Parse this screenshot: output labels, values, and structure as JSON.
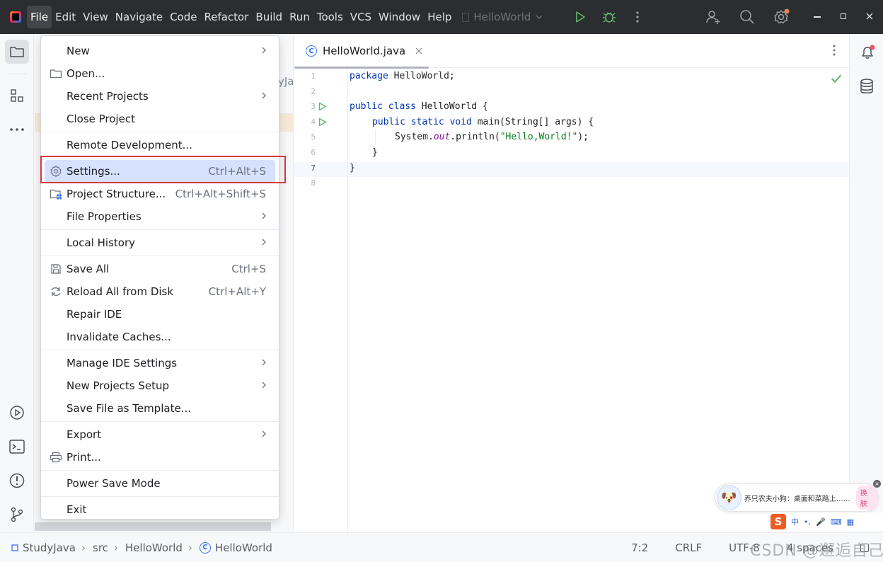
{
  "menubar": {
    "items": [
      "File",
      "Edit",
      "View",
      "Navigate",
      "Code",
      "Refactor",
      "Build",
      "Run",
      "Tools",
      "VCS",
      "Window",
      "Help"
    ],
    "project_name": "HelloWorld"
  },
  "project_panel": {
    "truncated_label": "yJa"
  },
  "file_menu": {
    "groups": [
      [
        {
          "label": "New",
          "submenu": true
        },
        {
          "label": "Open...",
          "icon": "folder-icon"
        },
        {
          "label": "Recent Projects",
          "submenu": true
        },
        {
          "label": "Close Project"
        }
      ],
      [
        {
          "label": "Remote Development..."
        }
      ],
      [
        {
          "label": "Settings...",
          "shortcut": "Ctrl+Alt+S",
          "icon": "gear-icon",
          "highlighted": true
        },
        {
          "label": "Project Structure...",
          "shortcut": "Ctrl+Alt+Shift+S",
          "icon": "project-structure-icon"
        },
        {
          "label": "File Properties",
          "submenu": true
        }
      ],
      [
        {
          "label": "Local History",
          "submenu": true
        }
      ],
      [
        {
          "label": "Save All",
          "shortcut": "Ctrl+S",
          "icon": "save-icon"
        },
        {
          "label": "Reload All from Disk",
          "shortcut": "Ctrl+Alt+Y",
          "icon": "reload-icon"
        },
        {
          "label": "Repair IDE"
        },
        {
          "label": "Invalidate Caches..."
        }
      ],
      [
        {
          "label": "Manage IDE Settings",
          "submenu": true
        },
        {
          "label": "New Projects Setup",
          "submenu": true
        },
        {
          "label": "Save File as Template..."
        }
      ],
      [
        {
          "label": "Export",
          "submenu": true
        },
        {
          "label": "Print...",
          "icon": "print-icon"
        }
      ],
      [
        {
          "label": "Power Save Mode"
        }
      ],
      [
        {
          "label": "Exit"
        }
      ]
    ]
  },
  "editor": {
    "tab_title": "HelloWorld.java",
    "line_numbers": [
      "1",
      "2",
      "3",
      "4",
      "5",
      "6",
      "7",
      "8"
    ],
    "code": {
      "l1_kw": "package",
      "l1_rest": " HelloWorld;",
      "l3_kw": "public class",
      "l3_rest": " HelloWorld {",
      "l4_kw": "public static void",
      "l4_rest": " main(String[] args) {",
      "l5_a": "System.",
      "l5_field": "out",
      "l5_b": ".println(",
      "l5_str": "\"Hello,World!\"",
      "l5_c": ");",
      "l6": "}",
      "l7": "}"
    }
  },
  "statusbar": {
    "breadcrumbs": [
      "StudyJava",
      "src",
      "HelloWorld",
      "HelloWorld"
    ],
    "position": "7:2",
    "line_sep": "CRLF",
    "encoding": "UTF-8",
    "indent": "4 spaces"
  },
  "watermark": "CSDN @邂逅自己",
  "ime": {
    "popup_text": "养只农夫小狗：桌面和菜路上……",
    "skin_button": "换肤",
    "logo": "S",
    "mode": "中"
  },
  "colors": {
    "accent": "#3574f0",
    "highlight": "#d5e1ff",
    "callout": "#d9363e",
    "run": "#5fb865"
  }
}
